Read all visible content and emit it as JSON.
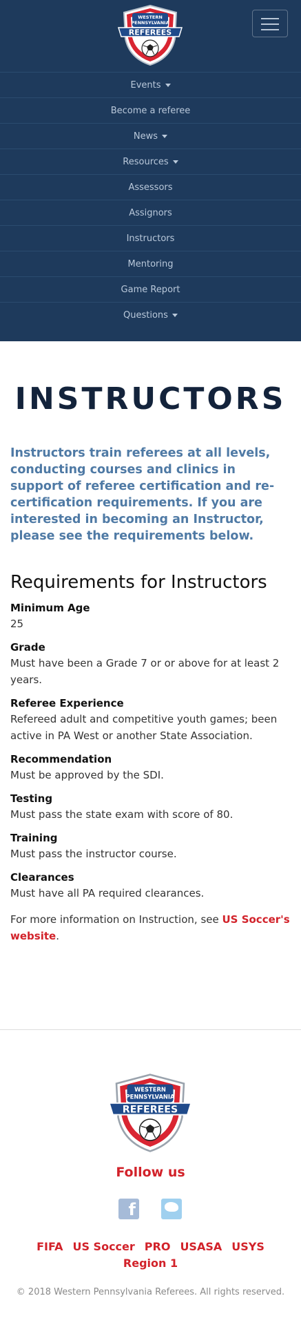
{
  "brand": {
    "logo_line1": "WESTERN",
    "logo_line2": "PENNSYLVANIA",
    "logo_line3": "REFEREES"
  },
  "nav": {
    "items": [
      {
        "label": "Events",
        "dropdown": true
      },
      {
        "label": "Become a referee",
        "dropdown": false
      },
      {
        "label": "News",
        "dropdown": true
      },
      {
        "label": "Resources",
        "dropdown": true
      },
      {
        "label": "Assessors",
        "dropdown": false
      },
      {
        "label": "Assignors",
        "dropdown": false
      },
      {
        "label": "Instructors",
        "dropdown": false
      },
      {
        "label": "Mentoring",
        "dropdown": false
      },
      {
        "label": "Game Report",
        "dropdown": false
      },
      {
        "label": "Questions",
        "dropdown": true
      }
    ]
  },
  "page": {
    "title": "INSTRUCTORS",
    "lead": "Instructors train referees at all levels, conducting courses and clinics in support of referee certification and re-certification requirements. If you are interested in becoming an Instructor, please see the requirements below.",
    "requirements_heading": "Requirements for Instructors",
    "requirements": [
      {
        "label": "Minimum Age",
        "value": "25"
      },
      {
        "label": "Grade",
        "value": "Must have been a Grade 7 or or above for at least 2 years."
      },
      {
        "label": "Referee Experience",
        "value": "Refereed adult and competitive youth games; been active in PA West or another State Association."
      },
      {
        "label": "Recommendation",
        "value": "Must be approved by the SDI."
      },
      {
        "label": "Testing",
        "value": "Must pass the state exam with score of 80."
      },
      {
        "label": "Training",
        "value": "Must pass the instructor course."
      },
      {
        "label": "Clearances",
        "value": "Must have all PA required clearances."
      }
    ],
    "more_info_prefix": "For more information on Instruction, see ",
    "more_info_link": "US Soccer's website",
    "more_info_suffix": "."
  },
  "footer": {
    "follow_label": "Follow us",
    "links": [
      "FIFA",
      "US Soccer",
      "PRO",
      "USASA",
      "USYS",
      "Region 1"
    ],
    "copyright": "© 2018 Western Pennsylvania Referees. All rights reserved."
  },
  "colors": {
    "nav_bg": "#1e3a5c",
    "accent_red": "#d2222a",
    "lead_blue": "#4f7aa5",
    "title_navy": "#13233b"
  },
  "icons": {
    "menu": "hamburger-menu-icon",
    "facebook": "facebook-icon",
    "twitter": "twitter-icon",
    "dropdown": "caret-down-icon"
  }
}
